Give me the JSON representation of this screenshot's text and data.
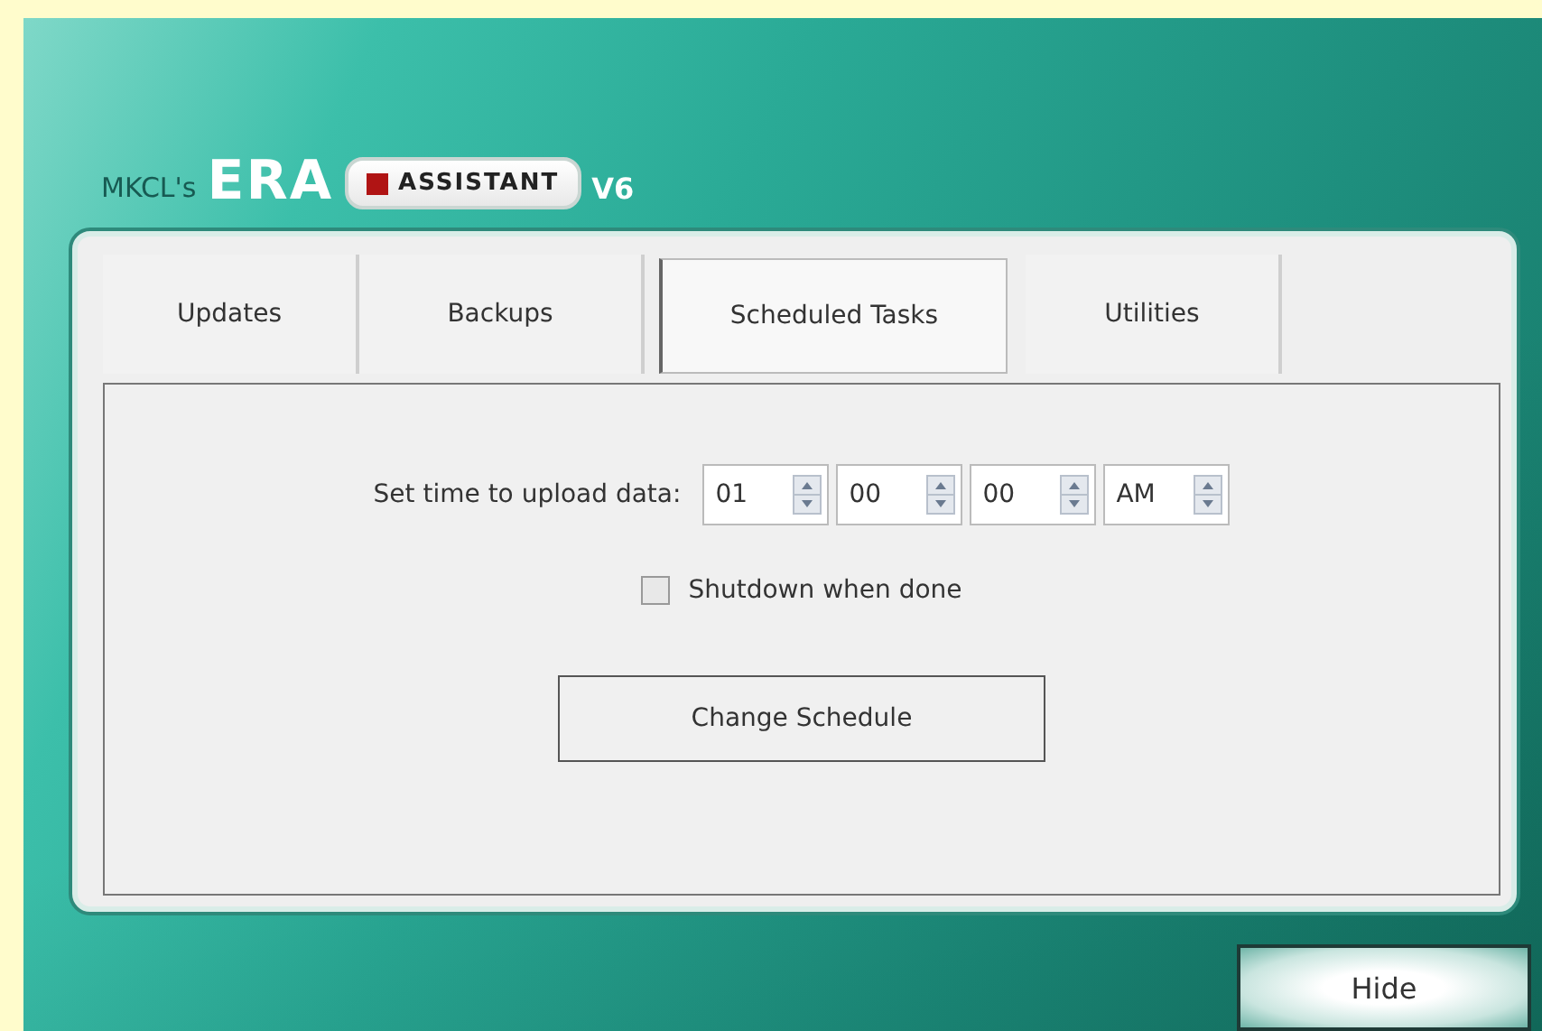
{
  "header": {
    "prefix": "MKCL's",
    "brand": "ERA",
    "badge": "ASSISTANT",
    "version": "V6"
  },
  "tabs": [
    {
      "label": "Updates",
      "selected": false
    },
    {
      "label": "Backups",
      "selected": false
    },
    {
      "label": "Scheduled Tasks",
      "selected": true
    },
    {
      "label": "Utilities",
      "selected": false
    }
  ],
  "schedule": {
    "label": "Set time to upload data:",
    "time_fields": [
      {
        "value": "01"
      },
      {
        "value": "00"
      },
      {
        "value": "00"
      },
      {
        "value": "AM"
      }
    ],
    "shutdown": {
      "label": "Shutdown when done",
      "checked": false
    },
    "button": "Change Schedule"
  },
  "hide_button": "Hide"
}
